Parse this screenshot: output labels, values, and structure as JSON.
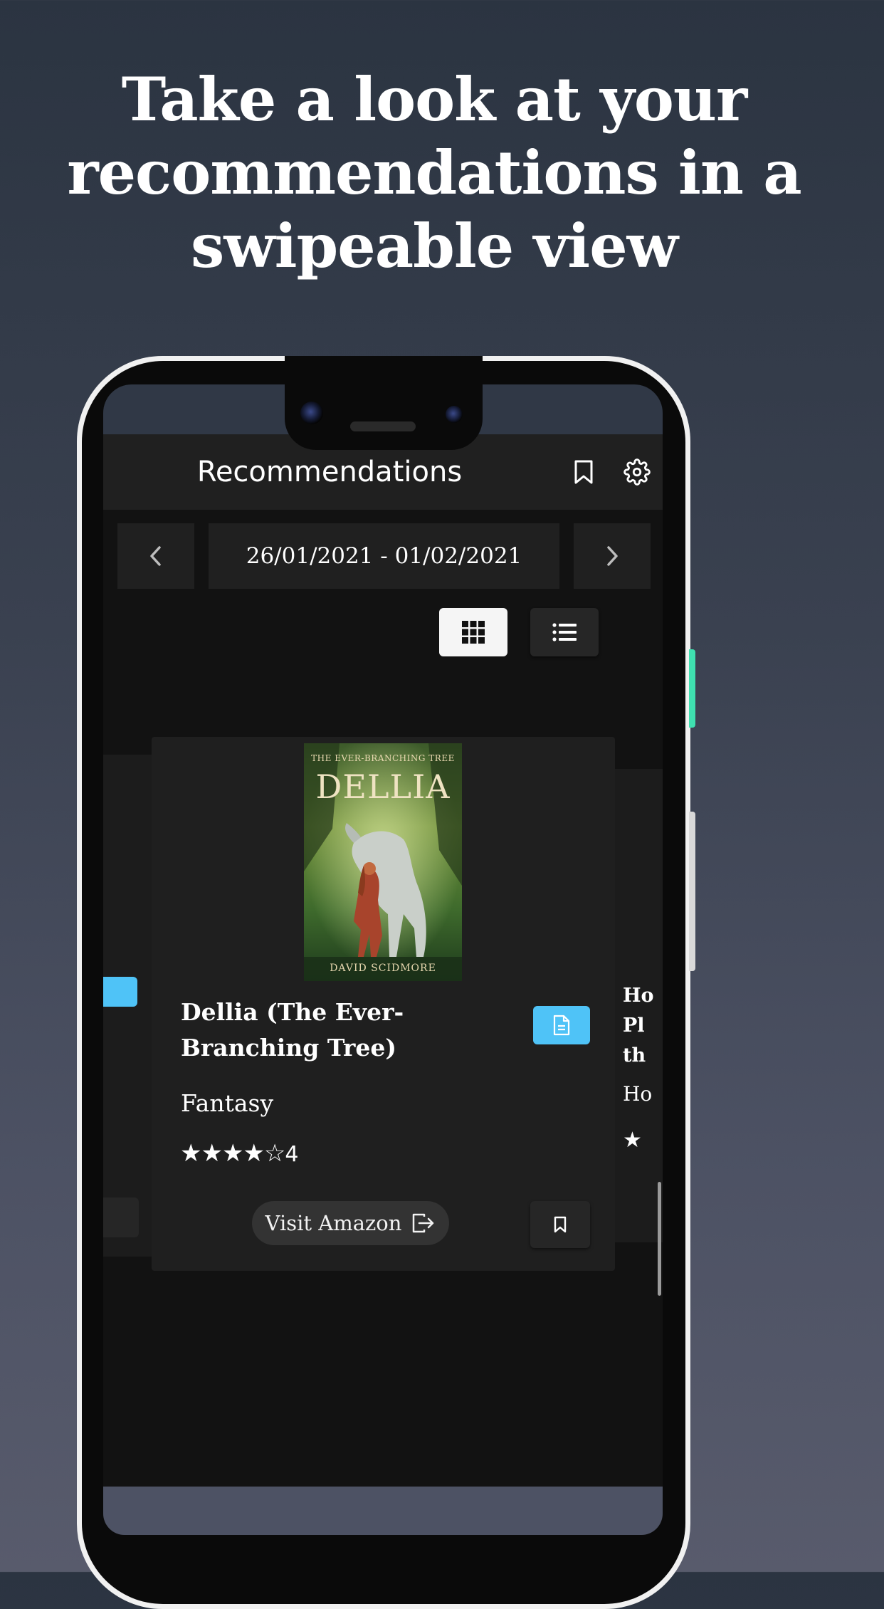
{
  "headline": [
    "Take a look at your",
    "recommendations in a",
    "swipeable view"
  ],
  "app": {
    "title": "Recommendations",
    "header_icons": [
      "bookmark-icon",
      "gear-icon"
    ],
    "date_range": "26/01/2021 - 01/02/2021",
    "prev_icon": "chevron-left-icon",
    "next_icon": "chevron-right-icon",
    "view_modes": [
      {
        "name": "grid-view",
        "icon": "grid-icon",
        "active": true
      },
      {
        "name": "list-view",
        "icon": "list-icon",
        "active": false
      }
    ]
  },
  "card": {
    "cover": {
      "series": "THE EVER-BRANCHING TREE",
      "title": "DELLIA",
      "author": "DAVID SCIDMORE"
    },
    "title": "Dellia (The Ever-Branching Tree)",
    "genre": "Fantasy",
    "stars": "★★★★☆",
    "rating": "4",
    "amazon_label": "Visit Amazon"
  },
  "next_card_partial": {
    "title_lines": [
      "Ho",
      "Pl",
      "th"
    ],
    "genre": "Ho",
    "stars": "★"
  },
  "colors": {
    "accent": "#4fc3f7",
    "background": "#121212",
    "card": "#1f1f1f",
    "appbar": "#202020"
  }
}
